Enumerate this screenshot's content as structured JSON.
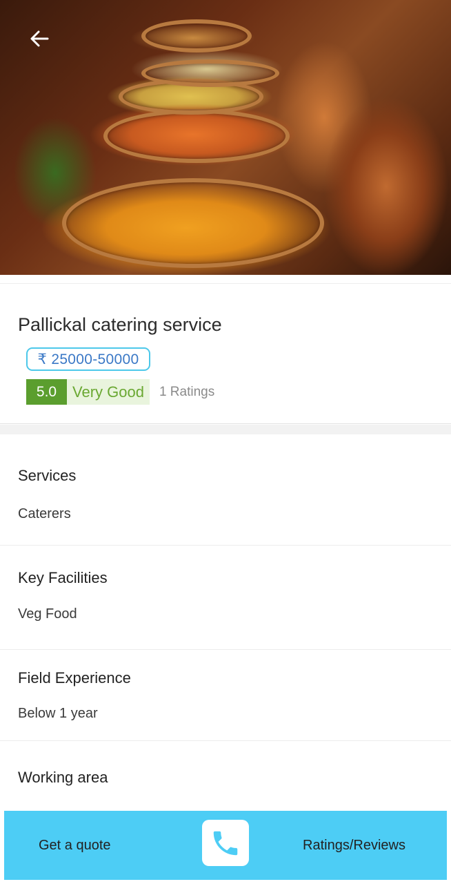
{
  "listing": {
    "name": "Pallickal catering service",
    "price_range": "₹ 25000-50000",
    "rating_score": "5.0",
    "rating_label": "Very Good",
    "rating_count": "1 Ratings"
  },
  "sections": [
    {
      "heading": "Services",
      "value": "Caterers"
    },
    {
      "heading": "Key Facilities",
      "value": "Veg Food"
    },
    {
      "heading": "Field Experience",
      "value": "Below 1 year"
    },
    {
      "heading": "Working area",
      "value": ""
    }
  ],
  "actions": {
    "quote_label": "Get a quote",
    "reviews_label": "Ratings/Reviews"
  },
  "icons": {
    "back": "arrow-left-icon",
    "call": "phone-icon"
  },
  "colors": {
    "accent": "#4dcdf5",
    "price_border": "#4cc8ea",
    "price_text": "#3a78c6",
    "rating_green": "#5b9e2e",
    "rating_bg": "#e9f4dd"
  }
}
